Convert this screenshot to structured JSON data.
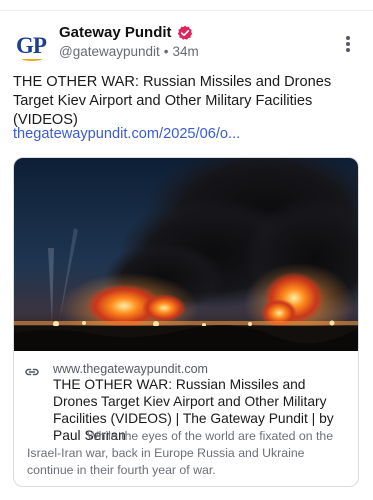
{
  "account": {
    "name": "Gateway Pundit",
    "handle": "@gatewaypundit",
    "time": "34m",
    "avatar_text": "GP",
    "verified_color": "#e0245e"
  },
  "post": {
    "text": "THE OTHER WAR: Russian Missiles and Drones Target Kiev Airport and Other Military Facilities (VIDEOS)",
    "link": "thegatewaypundit.com/2025/06/o..."
  },
  "card": {
    "domain": "www.thegatewaypundit.com",
    "title": "THE OTHER WAR: Russian Missiles and Drones Target Kiev Airport and Other Military Facilities (VIDEOS) | The Gateway Pundit | by Paul Serran",
    "description": "While the eyes of the world are fixated on the Israel-Iran war, back in Europe Russia and Ukraine continue in their fourth year of war."
  },
  "icons": {
    "verified": "verified-badge-icon",
    "more": "more-vertical-icon",
    "link": "link-icon"
  },
  "colors": {
    "link": "#3b5bd6",
    "accent_brand": "#1c3f94"
  }
}
